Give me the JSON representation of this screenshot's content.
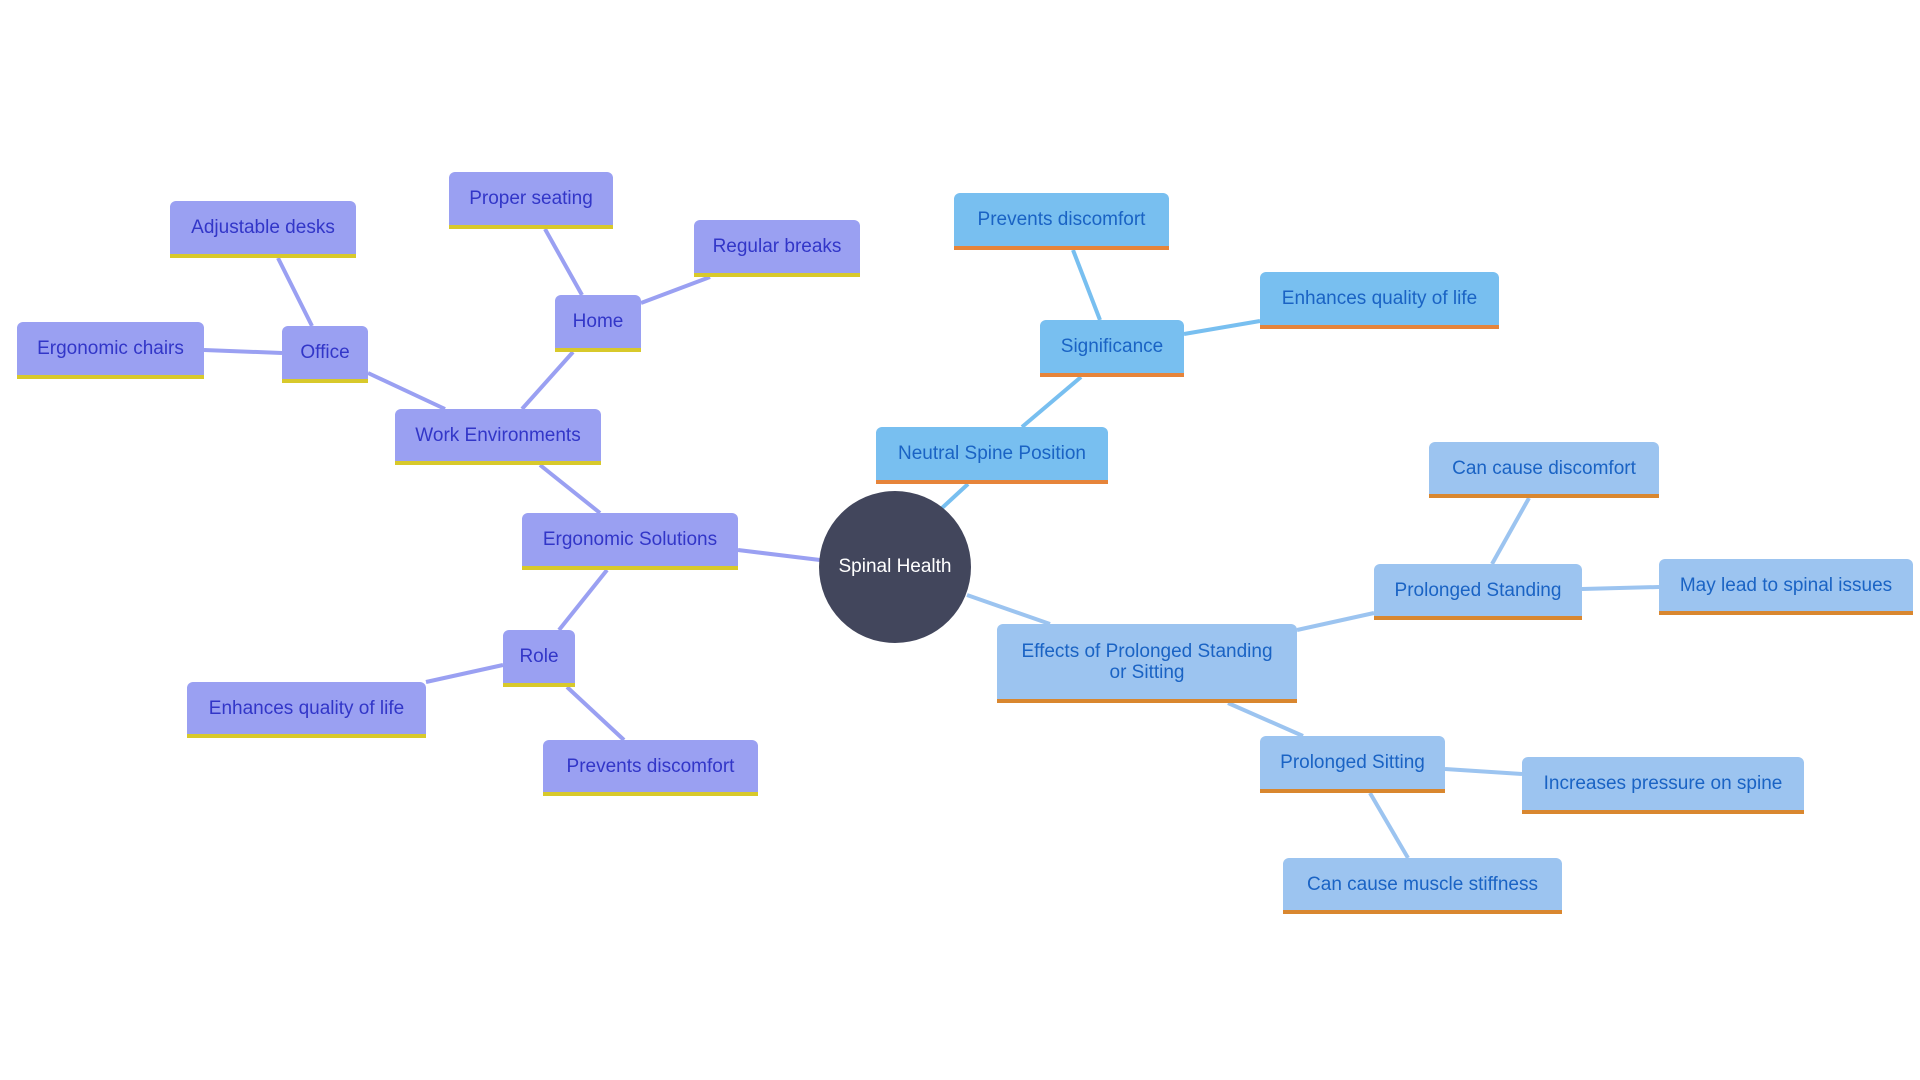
{
  "root": {
    "label": "Spinal Health"
  },
  "colors": {
    "purple_branch": "#9aa0f2",
    "purple_text": "#3236c8",
    "purple_accent": "#d8c92b",
    "blue_branch": "#78bff0",
    "light_blue_branch": "#9cc4f0",
    "blue_text": "#1a63c4",
    "blue_accent": "#e6843a",
    "root_fill": "#42465c"
  },
  "nodes": {
    "ergonomic_solutions": "Ergonomic Solutions",
    "work_environments": "Work Environments",
    "office": "Office",
    "adjustable_desks": "Adjustable desks",
    "ergonomic_chairs": "Ergonomic chairs",
    "home": "Home",
    "proper_seating": "Proper seating",
    "regular_breaks": "Regular breaks",
    "role": "Role",
    "role_enhances": "Enhances quality of life",
    "role_prevents": "Prevents discomfort",
    "neutral_spine": "Neutral Spine Position",
    "significance": "Significance",
    "sig_prevents": "Prevents discomfort",
    "sig_enhances": "Enhances quality of life",
    "effects": "Effects of Prolonged Standing or Sitting",
    "prolonged_standing": "Prolonged Standing",
    "standing_discomfort": "Can cause discomfort",
    "standing_issues": "May lead to spinal issues",
    "prolonged_sitting": "Prolonged Sitting",
    "sitting_pressure": "Increases pressure on spine",
    "sitting_stiffness": "Can cause muscle stiffness"
  }
}
